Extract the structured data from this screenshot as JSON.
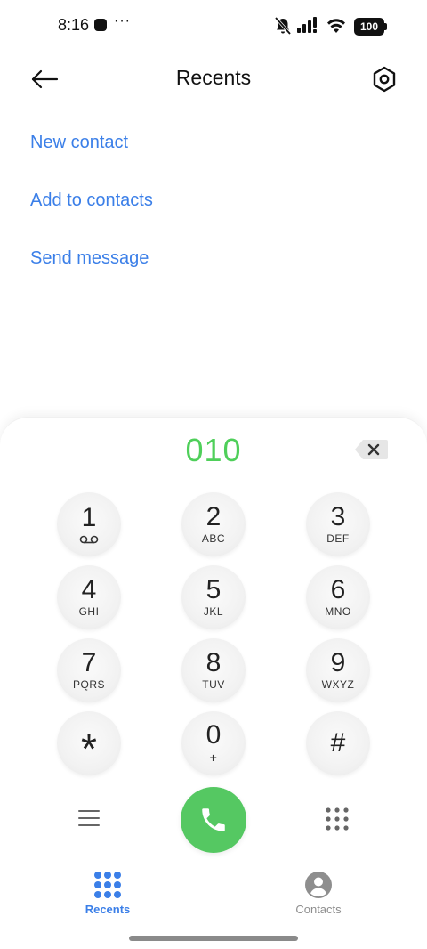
{
  "status_bar": {
    "time": "8:16",
    "more": "···",
    "battery": "100"
  },
  "header": {
    "title": "Recents"
  },
  "actions": [
    {
      "label": "New contact"
    },
    {
      "label": "Add to contacts"
    },
    {
      "label": "Send message"
    }
  ],
  "dialer": {
    "number": "010",
    "keys": [
      {
        "digit": "1",
        "letters": ""
      },
      {
        "digit": "2",
        "letters": "ABC"
      },
      {
        "digit": "3",
        "letters": "DEF"
      },
      {
        "digit": "4",
        "letters": "GHI"
      },
      {
        "digit": "5",
        "letters": "JKL"
      },
      {
        "digit": "6",
        "letters": "MNO"
      },
      {
        "digit": "7",
        "letters": "PQRS"
      },
      {
        "digit": "8",
        "letters": "TUV"
      },
      {
        "digit": "9",
        "letters": "WXYZ"
      },
      {
        "digit": "*",
        "letters": ""
      },
      {
        "digit": "0",
        "letters": "+"
      },
      {
        "digit": "#",
        "letters": ""
      }
    ]
  },
  "bottom_nav": {
    "recents": "Recents",
    "contacts": "Contacts"
  },
  "colors": {
    "accent": "#3b7fe8",
    "number": "#4fcf5a",
    "call": "#55c862",
    "inactive": "#8e8e8e"
  }
}
